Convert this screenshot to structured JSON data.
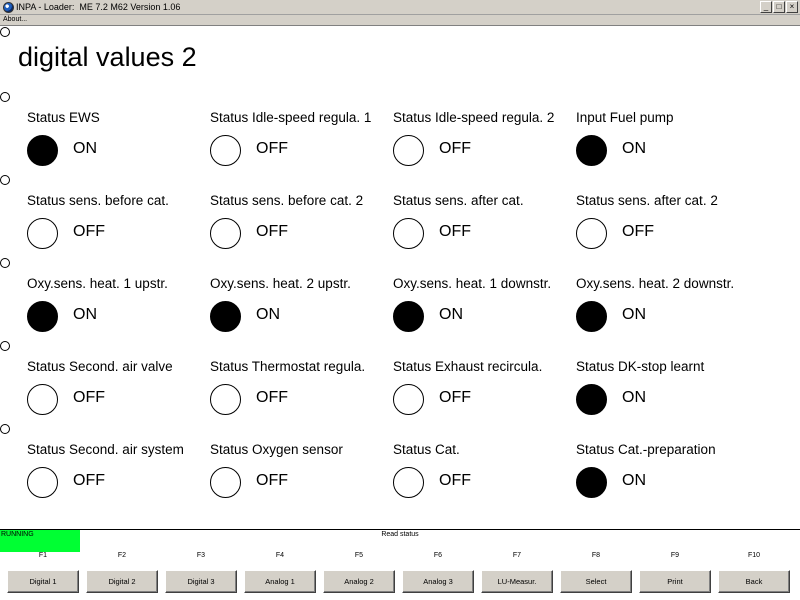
{
  "window": {
    "title": "INPA - Loader:  ME 7.2 M62 Version 1.06",
    "minimize": "_",
    "maximize": "□",
    "close": "×"
  },
  "menu": {
    "about": "About..."
  },
  "page_title": "digital values 2",
  "signals": [
    [
      {
        "label": "Status EWS",
        "state": "ON"
      },
      {
        "label": "Status Idle-speed regula. 1",
        "state": "OFF"
      },
      {
        "label": "Status Idle-speed regula. 2",
        "state": "OFF"
      },
      {
        "label": "Input Fuel pump",
        "state": "ON"
      }
    ],
    [
      {
        "label": "Status sens. before cat.",
        "state": "OFF"
      },
      {
        "label": "Status sens. before cat. 2",
        "state": "OFF"
      },
      {
        "label": "Status sens. after cat.",
        "state": "OFF"
      },
      {
        "label": "Status sens. after cat. 2",
        "state": "OFF"
      }
    ],
    [
      {
        "label": "Oxy.sens. heat. 1 upstr.",
        "state": "ON"
      },
      {
        "label": "Oxy.sens. heat. 2 upstr.",
        "state": "ON"
      },
      {
        "label": "Oxy.sens. heat. 1 downstr.",
        "state": "ON"
      },
      {
        "label": "Oxy.sens. heat. 2 downstr.",
        "state": "ON"
      }
    ],
    [
      {
        "label": "Status Second. air valve",
        "state": "OFF"
      },
      {
        "label": "Status Thermostat regula.",
        "state": "OFF"
      },
      {
        "label": "Status Exhaust recircula.",
        "state": "OFF"
      },
      {
        "label": "Status DK-stop learnt",
        "state": "ON"
      }
    ],
    [
      {
        "label": "Status Second. air system",
        "state": "OFF"
      },
      {
        "label": "Status Oxygen sensor",
        "state": "OFF"
      },
      {
        "label": "Status Cat.",
        "state": "OFF"
      },
      {
        "label": "Status Cat.-preparation",
        "state": "ON"
      }
    ]
  ],
  "status_bar": {
    "running": "RUNNING",
    "running_color": "#00ff33",
    "message": "Read status"
  },
  "function_keys": [
    {
      "key": "F1",
      "label": "Digital 1"
    },
    {
      "key": "F2",
      "label": "Digital 2"
    },
    {
      "key": "F3",
      "label": "Digital 3"
    },
    {
      "key": "F4",
      "label": "Analog 1"
    },
    {
      "key": "F5",
      "label": "Analog 2"
    },
    {
      "key": "F6",
      "label": "Analog 3"
    },
    {
      "key": "F7",
      "label": "LU-Measur."
    },
    {
      "key": "F8",
      "label": "Select"
    },
    {
      "key": "F9",
      "label": "Print"
    },
    {
      "key": "F10",
      "label": "Back"
    }
  ]
}
